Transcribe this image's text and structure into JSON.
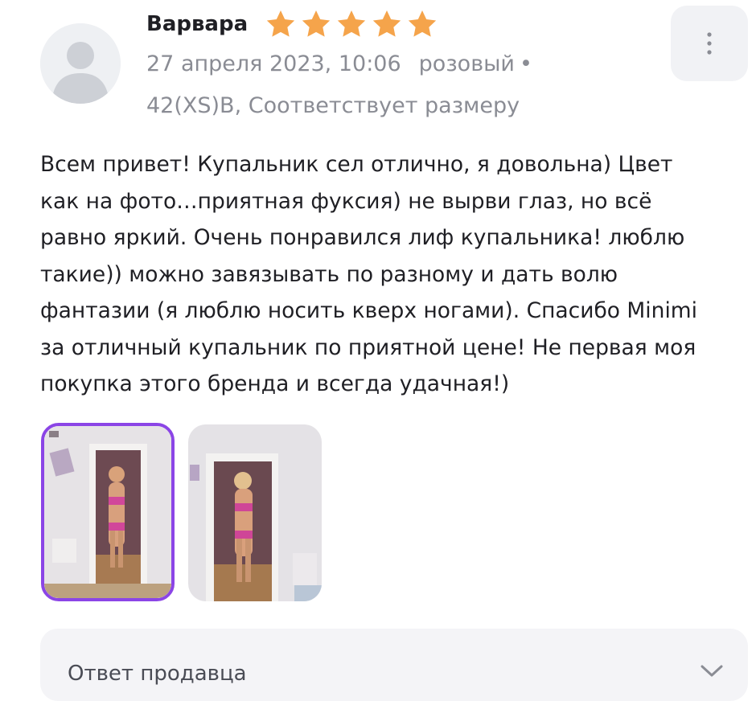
{
  "review": {
    "author": "Варвара",
    "rating": 5,
    "rating_max": 5,
    "date": "27 апреля 2023, 10:06",
    "color": "розовый",
    "size_line": "42(XS)B, Соответствует размеру",
    "text_lines": [
      "Всем привет! Купальник сел отлично, я довольна) Цвет",
      "как на фото…приятная фуксия) не вырви глаз, но всё",
      "равно яркий. Очень понравился лиф купальника! люблю",
      "такие)) можно завязывать по разному и дать волю",
      "фантазии (я люблю носить кверх ногами). Спасибо Minimi",
      "за отличный купальник по приятной цене! Не первая моя",
      "покупка этого бренда и всегда удачная!)"
    ],
    "photos": [
      {
        "name": "review-photo",
        "selected": true
      },
      {
        "name": "review-photo",
        "selected": false
      }
    ]
  },
  "seller_answer": {
    "title": "Ответ продавца"
  },
  "colors": {
    "star": "#f5a44b",
    "accent": "#8b45e6",
    "meta": "#8a8c94",
    "text": "#1f1f24",
    "panel": "#f4f4f7"
  }
}
